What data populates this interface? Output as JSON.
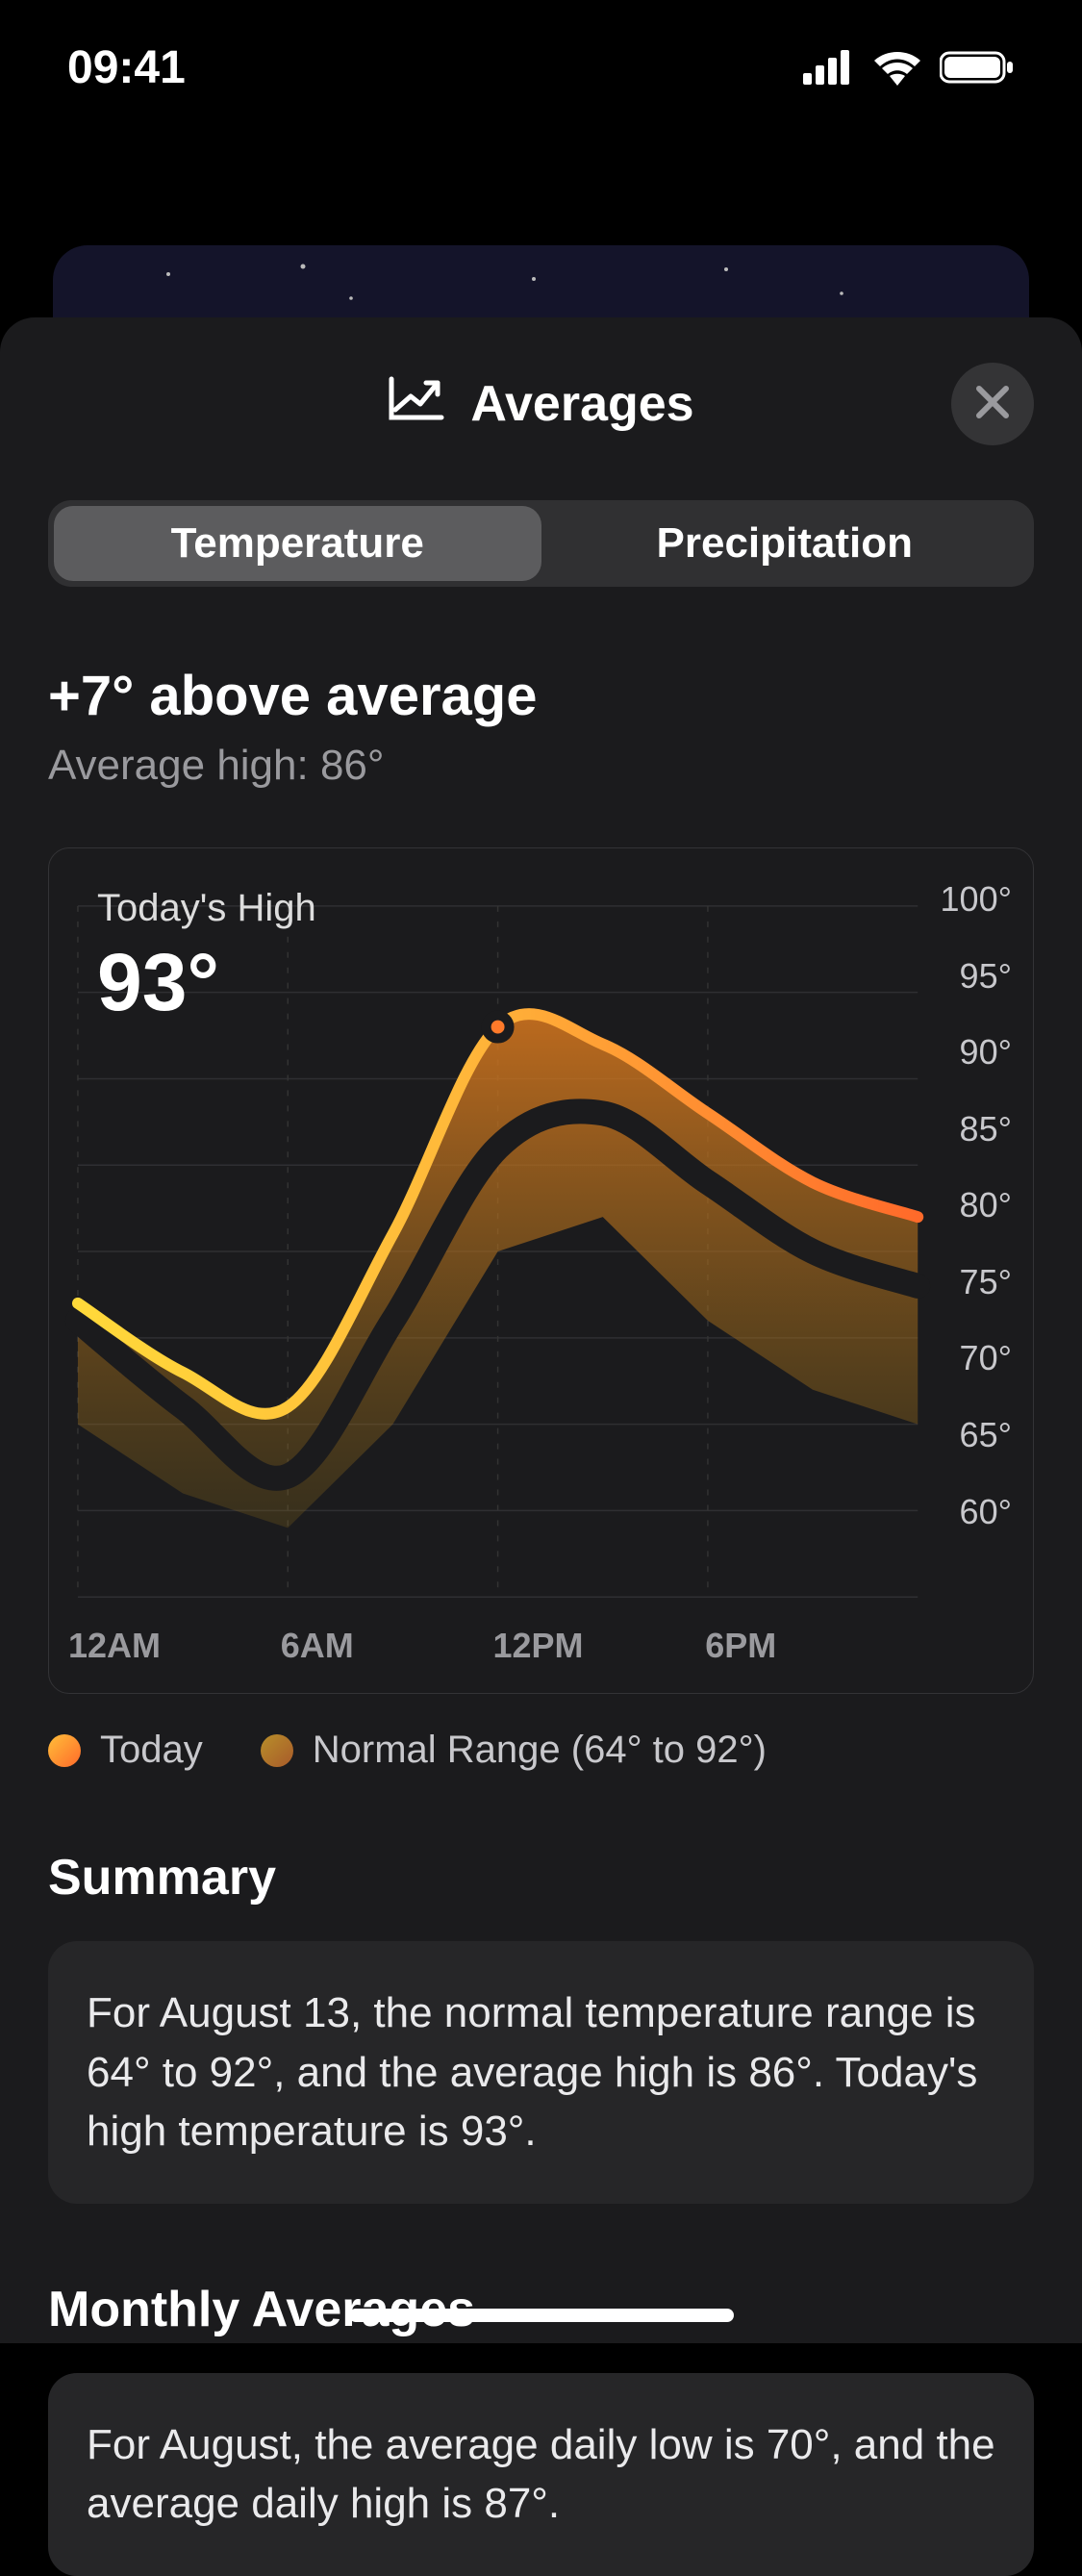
{
  "status": {
    "time": "09:41"
  },
  "sheet": {
    "title": "Averages"
  },
  "tabs": {
    "temperature": "Temperature",
    "precipitation": "Precipitation",
    "active": "temperature"
  },
  "headline": "+7° above average",
  "subhead": "Average high: 86°",
  "overlay": {
    "label": "Today's High",
    "value": "93°"
  },
  "legend": {
    "today": "Today",
    "range": "Normal Range (64° to 92°)"
  },
  "summary": {
    "title": "Summary",
    "text": "For August 13, the normal temperature range is 64° to 92°, and the average high is 86°. Today's high temperature is 93°."
  },
  "monthly": {
    "title": "Monthly Averages",
    "text": "For August, the average daily low is 70°, and the average daily high is 87°."
  },
  "chart_data": {
    "type": "line",
    "xlabel": "",
    "ylabel": "",
    "ylim": [
      60,
      100
    ],
    "y_ticks": [
      100,
      95,
      90,
      85,
      80,
      75,
      70,
      65,
      60
    ],
    "categories": [
      "12AM",
      "6AM",
      "12PM",
      "6PM"
    ],
    "x_hours": [
      0,
      3,
      6,
      9,
      12,
      15,
      18,
      21,
      24
    ],
    "series": [
      {
        "name": "Today",
        "values": [
          77,
          73,
          71,
          81,
          93,
          92,
          88,
          84,
          82
        ]
      },
      {
        "name": "Normal Range High",
        "values": [
          76,
          71,
          67,
          76,
          86,
          88,
          84,
          80,
          78
        ]
      },
      {
        "name": "Normal Range Low",
        "values": [
          70,
          66,
          64,
          70,
          80,
          82,
          76,
          72,
          70
        ]
      }
    ],
    "normal_range_min": 64,
    "normal_range_max": 92,
    "peak_marker": {
      "hour": 12,
      "value": 93
    }
  }
}
